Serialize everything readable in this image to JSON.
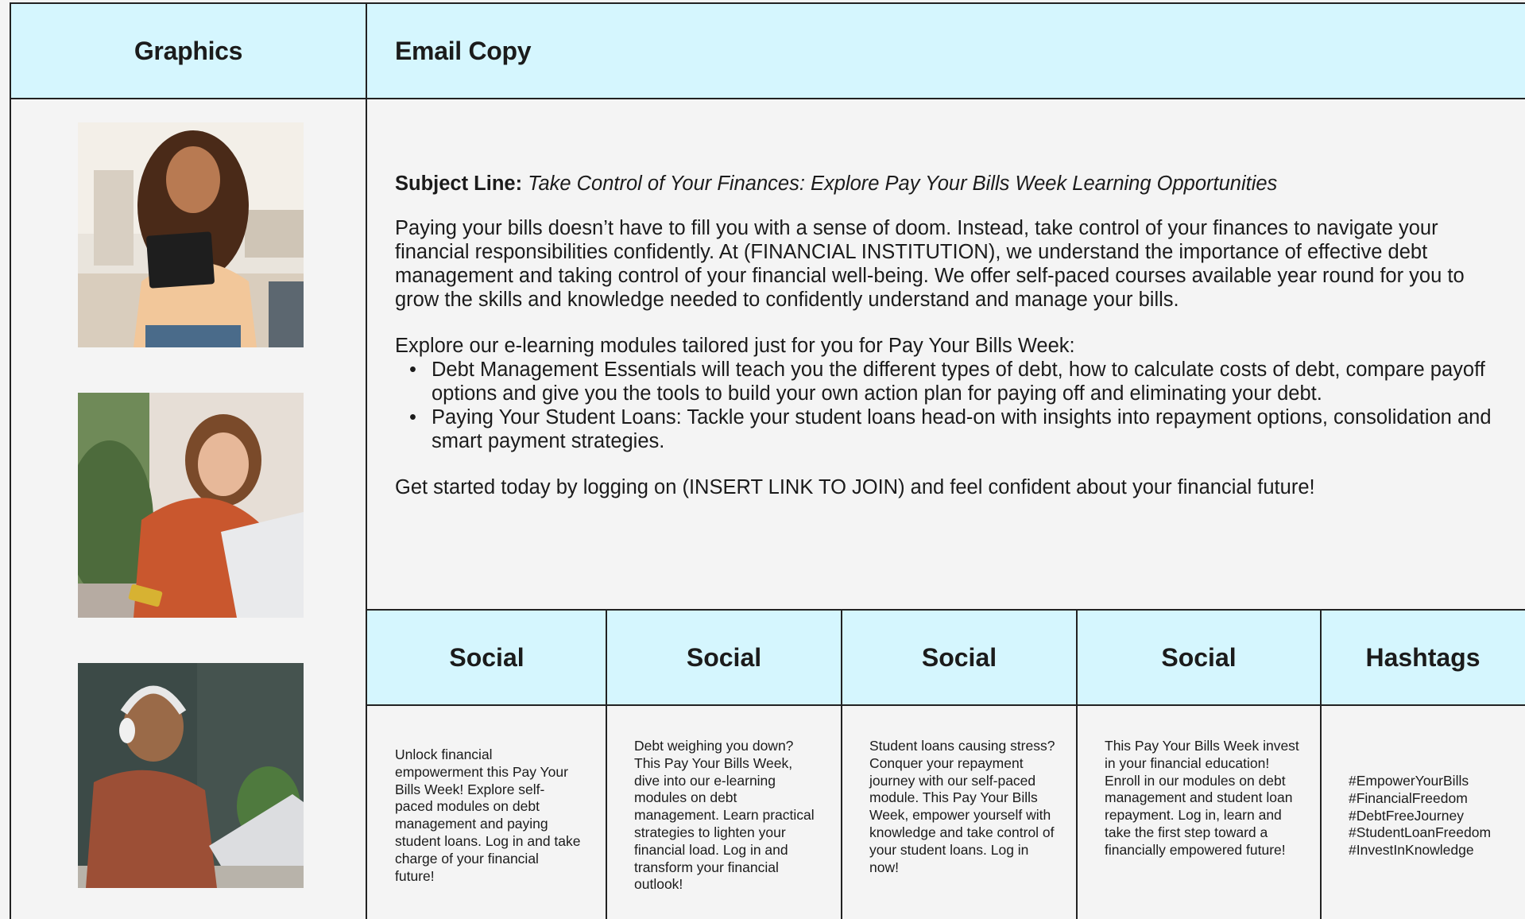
{
  "headers": {
    "graphics": "Graphics",
    "email": "Email Copy"
  },
  "images": [
    {
      "name": "woman-with-tablet-photo"
    },
    {
      "name": "woman-with-laptop-photo"
    },
    {
      "name": "man-with-headphones-photo"
    }
  ],
  "email": {
    "subject_label": "Subject Line:",
    "subject_text": "Take Control of Your Finances: Explore Pay Your Bills Week Learning Opportunities",
    "paragraph1": "Paying your bills doesn’t have to fill you with a sense of doom.  Instead, take control of your finances to navigate your financial responsibilities confidently.  At (FINANCIAL INSTITUTION), we understand the importance of effective debt management and taking control of your financial well-being.  We offer self-paced courses available year round for you to grow the skills and knowledge needed to confidently understand and manage your bills.",
    "intro": "Explore our e-learning modules tailored just for you for Pay Your Bills Week:",
    "bullets": [
      "Debt Management Essentials will teach you the different types of debt, how to calculate costs of debt, compare payoff options and give you the tools to build your own action plan for paying off and eliminating your debt.",
      "Paying Your Student Loans: Tackle your student loans head-on with insights into repayment options, consolidation and smart payment strategies."
    ],
    "closing": "Get started today by logging on (INSERT LINK TO JOIN) and feel confident about your financial future!"
  },
  "social": {
    "headers": [
      "Social",
      "Social",
      "Social",
      "Social",
      "Hashtags"
    ],
    "posts": [
      "Unlock financial empowerment this Pay Your Bills Week! Explore self-paced modules on debt management and paying student loans. Log in and take charge of your financial future!",
      "Debt weighing you down? This Pay Your Bills Week, dive into our e-learning modules on debt management. Learn practical strategies to lighten your financial load. Log in and transform your financial outlook!",
      "Student loans causing stress? Conquer your repayment journey with our self-paced module. This Pay Your Bills Week, empower yourself with knowledge and take control of your student loans. Log in now!",
      "This Pay Your Bills Week invest in your financial education! Enroll in our modules on debt management and student loan repayment. Log in, learn and take the first step toward a financially empowered future!"
    ],
    "hashtags": [
      "#EmpowerYourBills",
      "#FinancialFreedom",
      "#DebtFreeJourney",
      "#StudentLoanFreedom",
      "#InvestInKnowledge"
    ]
  },
  "colors": {
    "header_bg": "#d5f6fe",
    "body_bg": "#f4f4f4",
    "border": "#222222"
  }
}
